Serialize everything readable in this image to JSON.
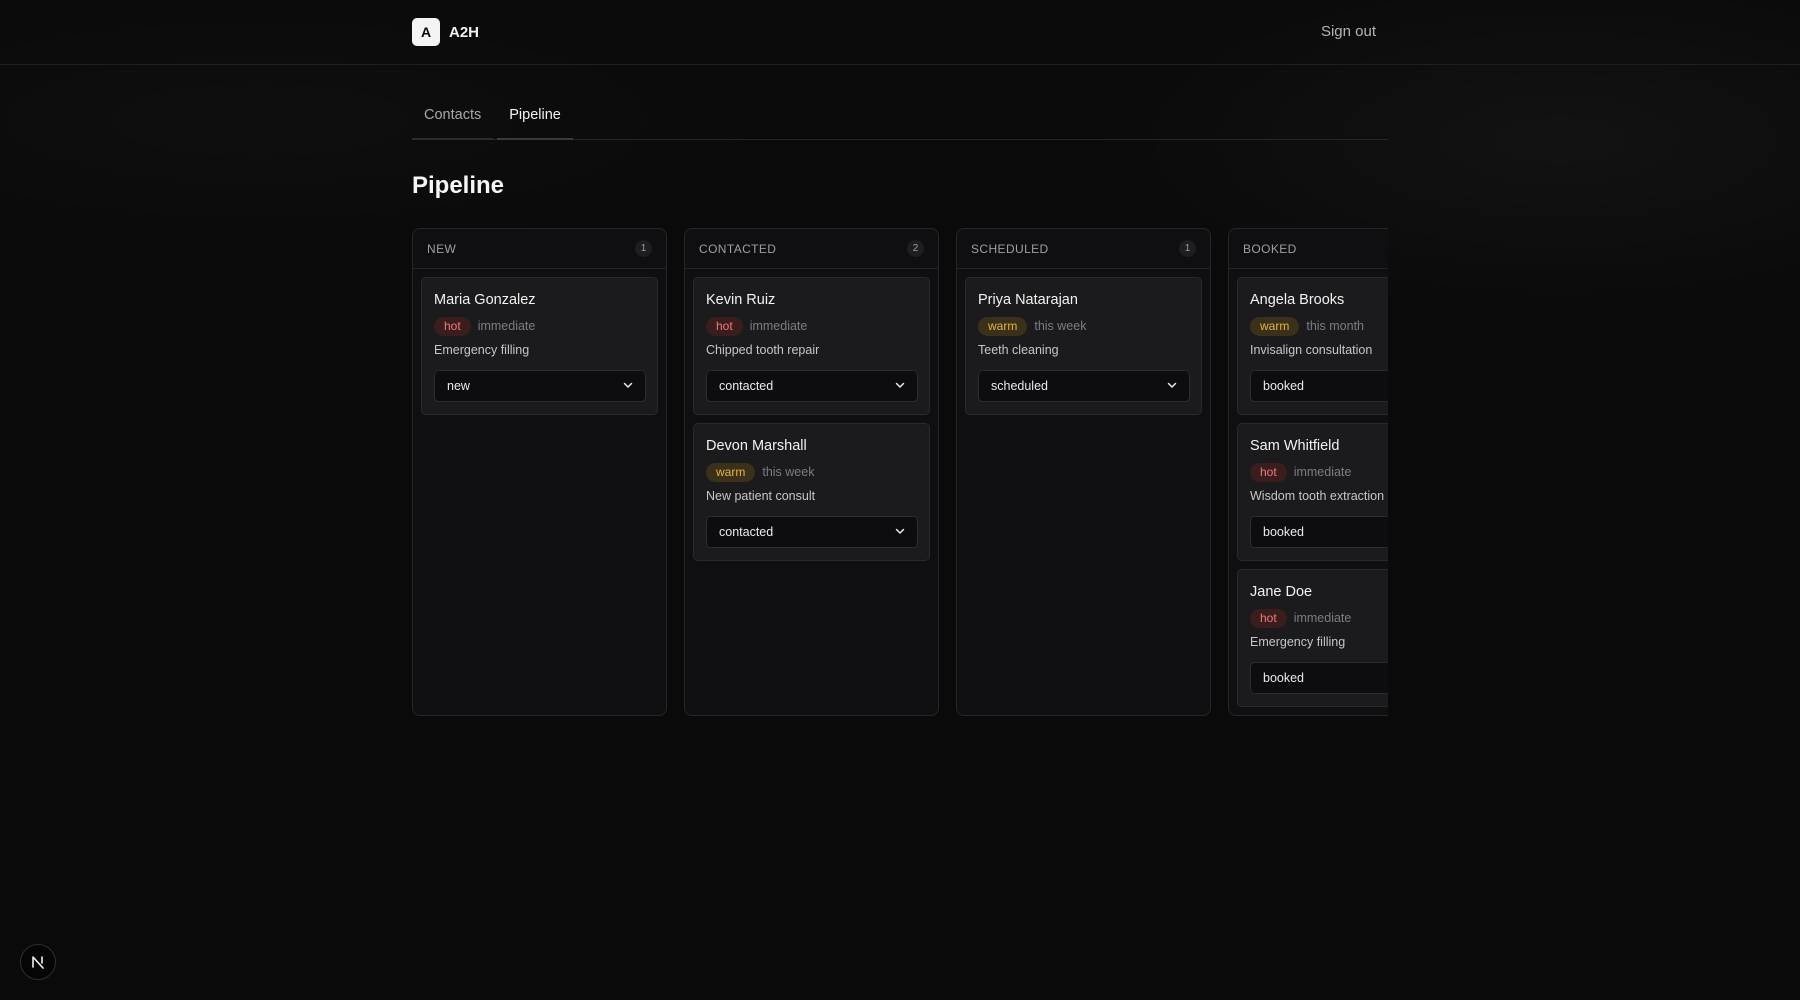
{
  "brand": {
    "mark": "A",
    "name": "A2H"
  },
  "header": {
    "signout_label": "Sign out"
  },
  "tabs": [
    {
      "label": "Contacts",
      "active": false
    },
    {
      "label": "Pipeline",
      "active": true
    }
  ],
  "page": {
    "title": "Pipeline"
  },
  "columns": [
    {
      "title": "NEW",
      "count": "1",
      "cards": [
        {
          "name": "Maria Gonzalez",
          "temperature": "hot",
          "timing": "immediate",
          "service": "Emergency filling",
          "status": "new"
        }
      ]
    },
    {
      "title": "CONTACTED",
      "count": "2",
      "cards": [
        {
          "name": "Kevin Ruiz",
          "temperature": "hot",
          "timing": "immediate",
          "service": "Chipped tooth repair",
          "status": "contacted"
        },
        {
          "name": "Devon Marshall",
          "temperature": "warm",
          "timing": "this week",
          "service": "New patient consult",
          "status": "contacted"
        }
      ]
    },
    {
      "title": "SCHEDULED",
      "count": "1",
      "cards": [
        {
          "name": "Priya Natarajan",
          "temperature": "warm",
          "timing": "this week",
          "service": "Teeth cleaning",
          "status": "scheduled"
        }
      ]
    },
    {
      "title": "BOOKED",
      "count": "",
      "cards": [
        {
          "name": "Angela Brooks",
          "temperature": "warm",
          "timing": "this month",
          "service": "Invisalign consultation",
          "status": "booked"
        },
        {
          "name": "Sam Whitfield",
          "temperature": "hot",
          "timing": "immediate",
          "service": "Wisdom tooth extraction",
          "status": "booked"
        },
        {
          "name": "Jane Doe",
          "temperature": "hot",
          "timing": "immediate",
          "service": "Emergency filling",
          "status": "booked"
        }
      ]
    }
  ],
  "colors": {
    "hot": "#f07a7a",
    "warm": "#e6b24a",
    "background": "#0a0a0b"
  },
  "corner_badge": {
    "icon": "nextjs-n-icon"
  }
}
